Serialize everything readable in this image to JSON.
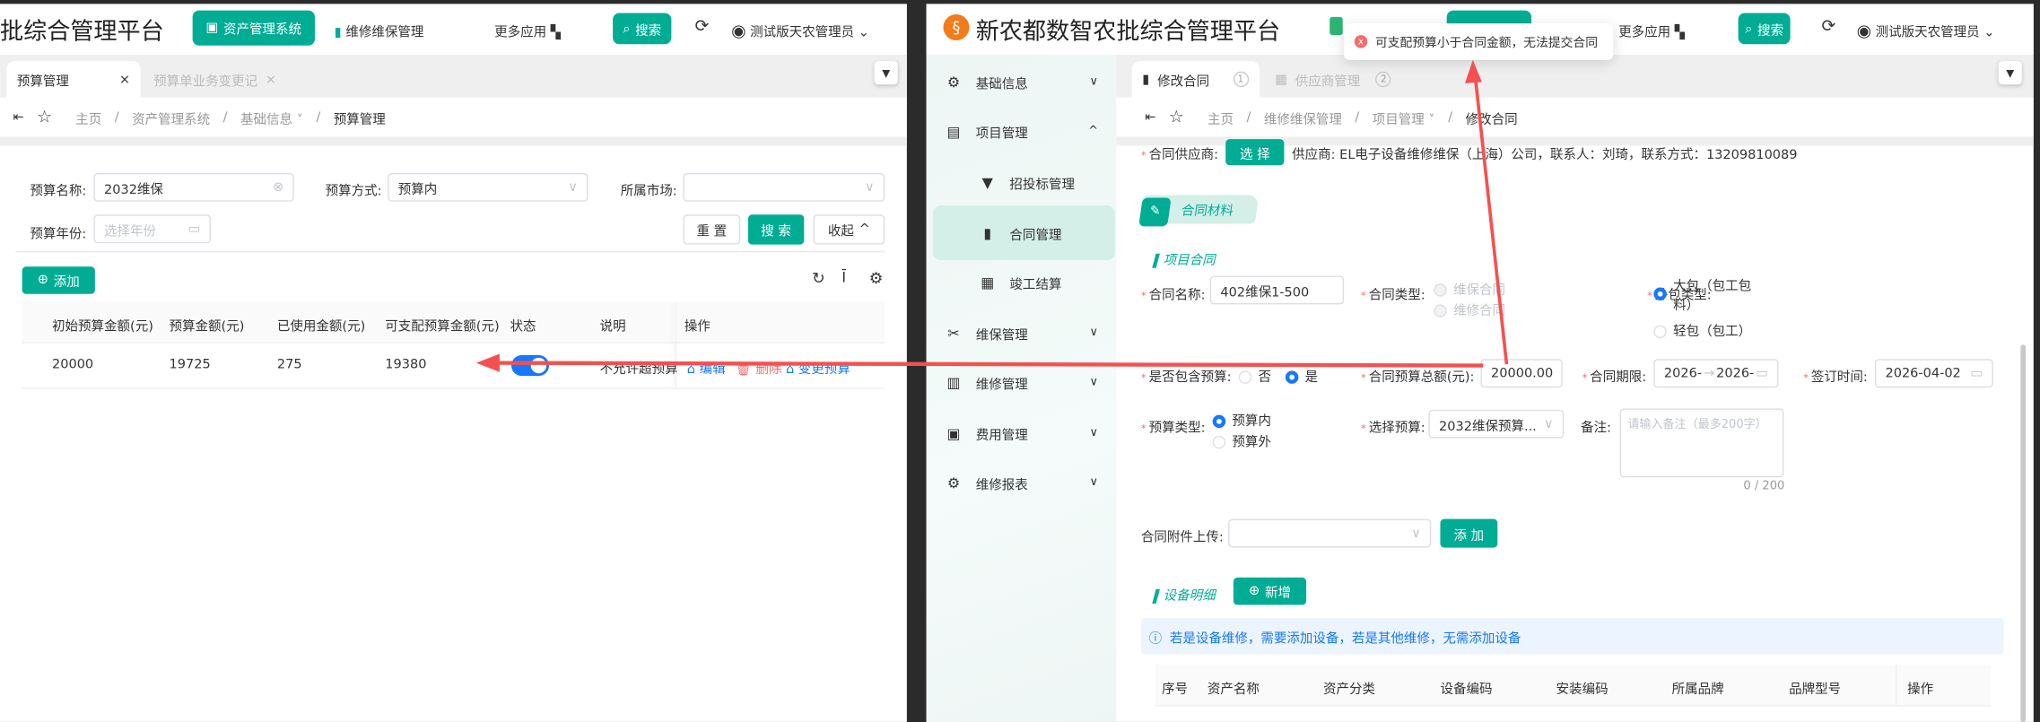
{
  "left": {
    "title": "批综合管理平台",
    "nav": {
      "asset_system": "资产管理系统",
      "maintenance": "维修维保管理",
      "more_apps": "更多应用",
      "search": "搜索",
      "user": "测试版天农管理员"
    },
    "tabs": [
      {
        "label": "预算管理",
        "close": "×"
      },
      {
        "label": "预算单业务变更记",
        "close": "×"
      }
    ],
    "breadcrumb": [
      "主页",
      "资产管理系统",
      "基础信息",
      "预算管理"
    ],
    "filters": {
      "name_label": "预算名称:",
      "name_value": "2032维保",
      "method_label": "预算方式:",
      "method_value": "预算内",
      "market_label": "所属市场:",
      "market_value": "",
      "year_label": "预算年份:",
      "year_placeholder": "选择年份",
      "reset": "重 置",
      "search": "搜 索",
      "collapse": "收起"
    },
    "add_button": "添加",
    "table": {
      "headers": [
        "初始预算金额(元)",
        "预算金额(元)",
        "已使用金额(元)",
        "可支配预算金额(元)",
        "状态",
        "说明",
        "操作"
      ],
      "rows": [
        {
          "initial": "20000",
          "budget": "19725",
          "used": "275",
          "available": "19380",
          "status_on": true,
          "note": "不允许超预算",
          "edit": "编辑",
          "delete": "删除",
          "change": "变更预算"
        }
      ]
    }
  },
  "right": {
    "title": "新农都数智农批综合管理平台",
    "nav": {
      "more_apps": "更多应用",
      "search": "搜索",
      "user": "测试版天农管理员"
    },
    "toast": "可支配预算小于合同金额，无法提交合同",
    "sidebar": [
      {
        "label": "基础信息",
        "chev": "⌄"
      },
      {
        "label": "项目管理",
        "chev": "^"
      },
      {
        "label": "招投标管理"
      },
      {
        "label": "合同管理",
        "active": true
      },
      {
        "label": "竣工结算"
      },
      {
        "label": "维保管理",
        "chev": "⌄"
      },
      {
        "label": "维修管理",
        "chev": "⌄"
      },
      {
        "label": "费用管理",
        "chev": "⌄"
      },
      {
        "label": "维修报表",
        "chev": "⌄"
      }
    ],
    "tabs": [
      {
        "label": "修改合同",
        "badge": "1"
      },
      {
        "label": "供应商管理",
        "badge": "2"
      }
    ],
    "breadcrumb": [
      "主页",
      "维修维保管理",
      "项目管理",
      "修改合同"
    ],
    "form": {
      "supplier_label": "合同供应商:",
      "select_btn": "选 择",
      "supplier_text": "供应商: EL电子设备维修维保（上海）公司，联系人：刘琦，联系方式：13209810089",
      "section_materials": "合同材料",
      "section_project": "项目合同",
      "name_label": "合同名称:",
      "name_value": "402维保1-500",
      "type_label": "合同类型:",
      "type_opt1": "维保合同",
      "type_opt2": "维修合同",
      "outsource_label": "外包类型:",
      "outsource_opt1_a": "大包（包工包",
      "outsource_opt1_b": "料）",
      "outsource_opt2": "轻包（包工）",
      "include_budget_label": "是否包含预算:",
      "no": "否",
      "yes": "是",
      "total_label": "合同预算总额(元):",
      "total_value": "20000.00",
      "period_label": "合同期限:",
      "period_start": "2026-",
      "period_arrow": "→",
      "period_end": "2026-",
      "sign_label": "签订时间:",
      "sign_value": "2026-04-02",
      "budget_type_label": "预算类型:",
      "budget_in": "预算内",
      "budget_out": "预算外",
      "choose_budget_label": "选择预算:",
      "choose_budget_value": "2032维保预算...",
      "remark_label": "备注:",
      "remark_placeholder": "请输入备注（最多200字）",
      "remark_count": "0 / 200",
      "attach_label": "合同附件上传:",
      "attach_add": "添 加",
      "section_equipment": "设备明细",
      "new_btn": "新增",
      "info": "若是设备维修，需要添加设备，若是其他维修，无需添加设备",
      "table_headers": [
        "序号",
        "资产名称",
        "资产分类",
        "设备编码",
        "安装编码",
        "所属品牌",
        "品牌型号",
        "操作"
      ]
    }
  },
  "colors": {
    "primary": "#00ad94",
    "arrow": "#f5504f",
    "link": "#1677ff",
    "danger": "#f56c6c"
  }
}
